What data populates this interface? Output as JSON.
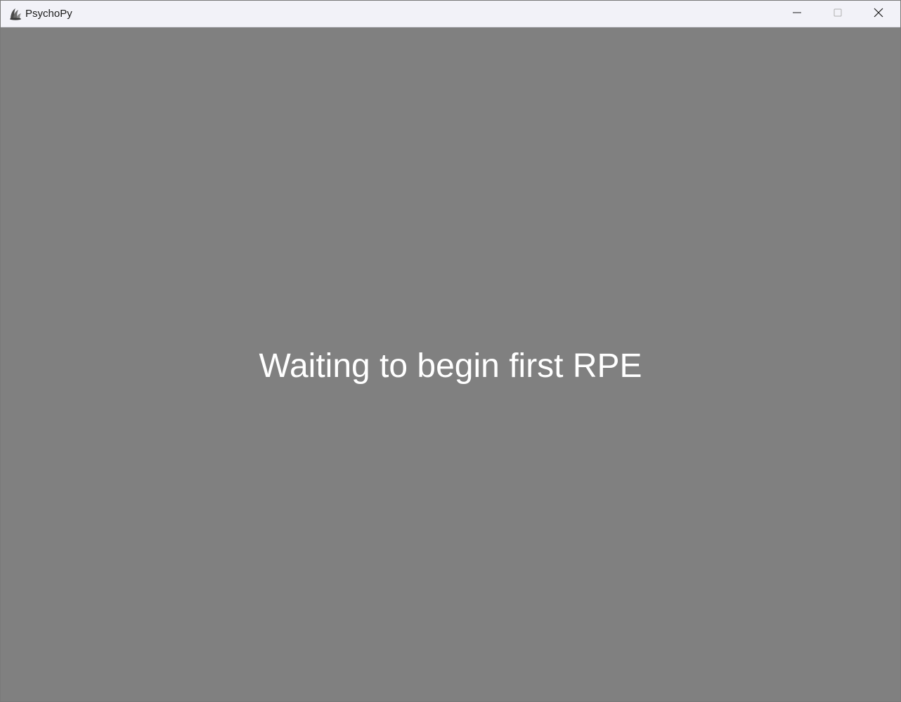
{
  "window": {
    "title": "PsychoPy",
    "background_color": "#808080",
    "titlebar_color": "#f2f2f8"
  },
  "titlebar": {
    "icon": "psychopy-logo-icon",
    "controls": [
      "minimize-icon",
      "maximize-icon",
      "close-icon"
    ]
  },
  "stimulus": {
    "text": "Waiting to begin first RPE",
    "color": "#ffffff"
  }
}
